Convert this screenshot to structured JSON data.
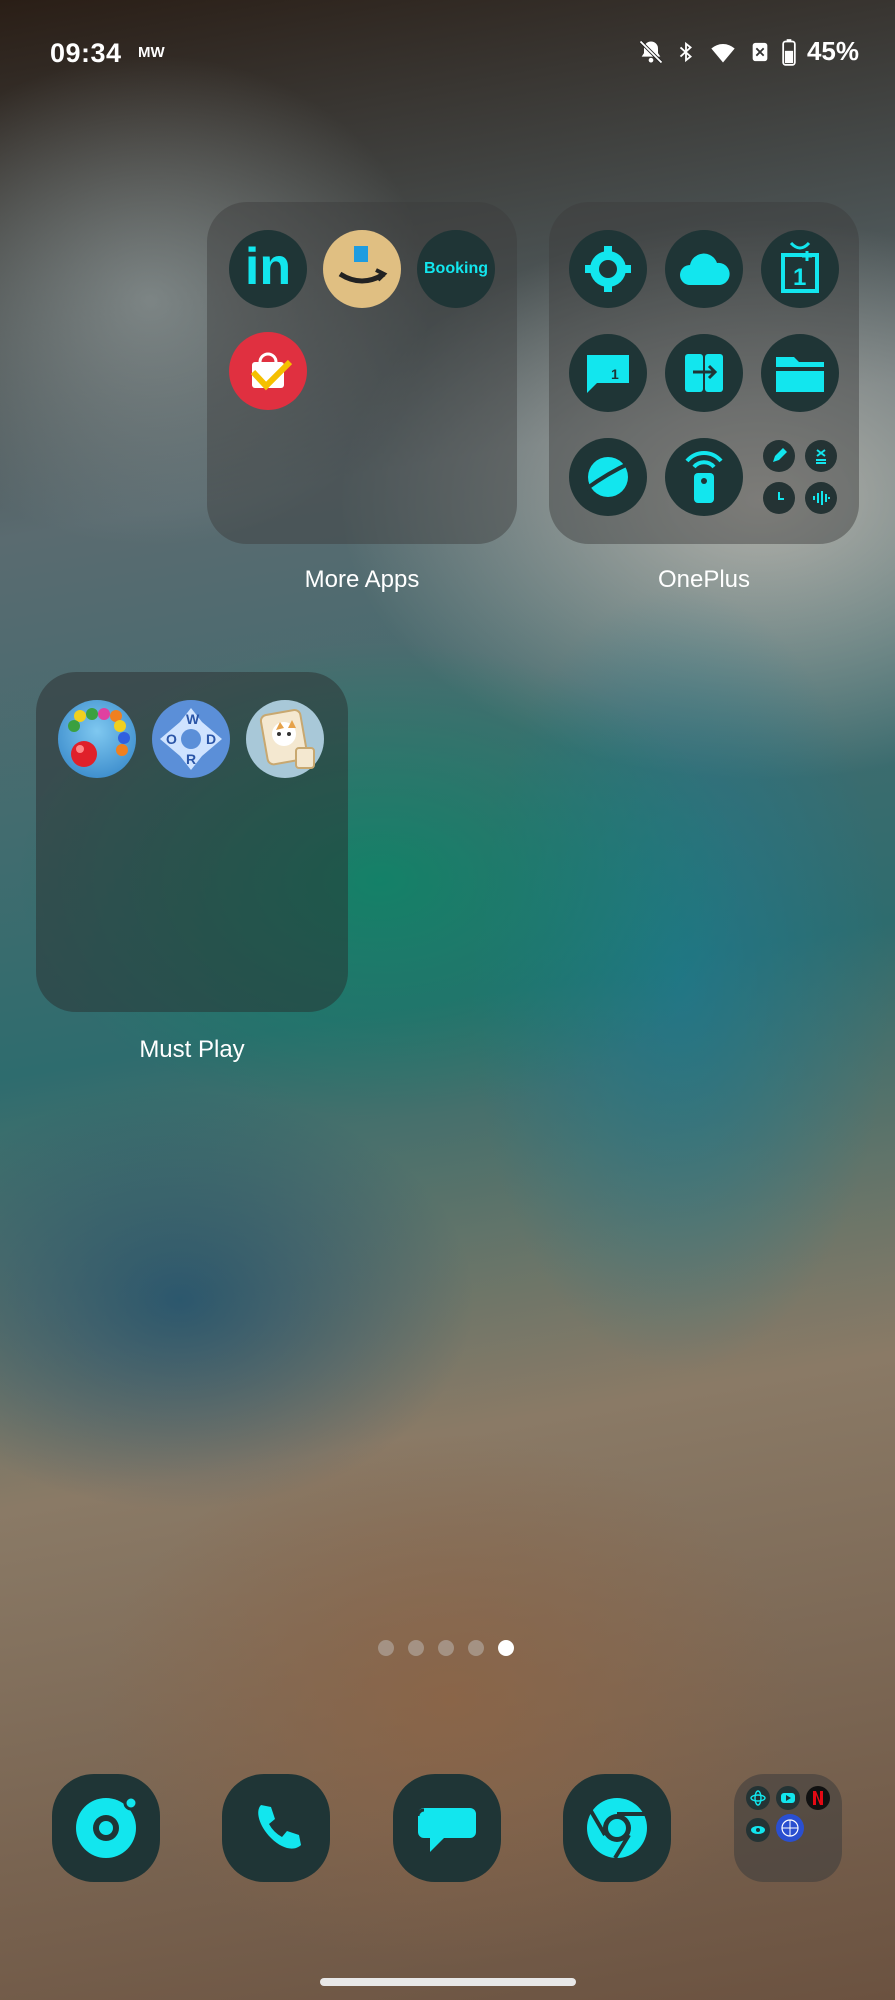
{
  "status_bar": {
    "time": "09:34",
    "notification_text": "MW",
    "battery_percent": "45%",
    "icons": [
      "bell-off-icon",
      "bluetooth-icon",
      "wifi-icon",
      "sim-x-icon",
      "battery-icon"
    ]
  },
  "folders": [
    {
      "label": "More Apps",
      "apps": [
        "LinkedIn",
        "Amazon",
        "Booking",
        "shopping-bag"
      ]
    },
    {
      "label": "OnePlus",
      "apps": [
        "Settings",
        "Weather",
        "OnePlus Store",
        "Messages",
        "Clone Phone",
        "Files",
        "Browser",
        "Remote",
        "Tools"
      ]
    },
    {
      "label": "Must Play",
      "apps": [
        "Bubble Shooter",
        "Word Game",
        "Mahjong"
      ]
    }
  ],
  "app_text": {
    "linkedin": "in",
    "booking": "Booking",
    "oneplus_store": "1",
    "messages_badge": "1",
    "word_letters": [
      "W",
      "O",
      "D",
      "R"
    ]
  },
  "page_indicator": {
    "total": 5,
    "active": 5
  },
  "dock": {
    "apps": [
      "Camera",
      "Phone",
      "Messages",
      "Chrome"
    ],
    "folder_apps": [
      "atom-icon",
      "youtube-icon",
      "netflix-icon",
      "eye-icon",
      "globe-icon"
    ]
  },
  "colors": {
    "accent": "#12e6ee",
    "icon_background": "#1f3536",
    "folder_background": "rgba(60,60,60,0.45)"
  }
}
